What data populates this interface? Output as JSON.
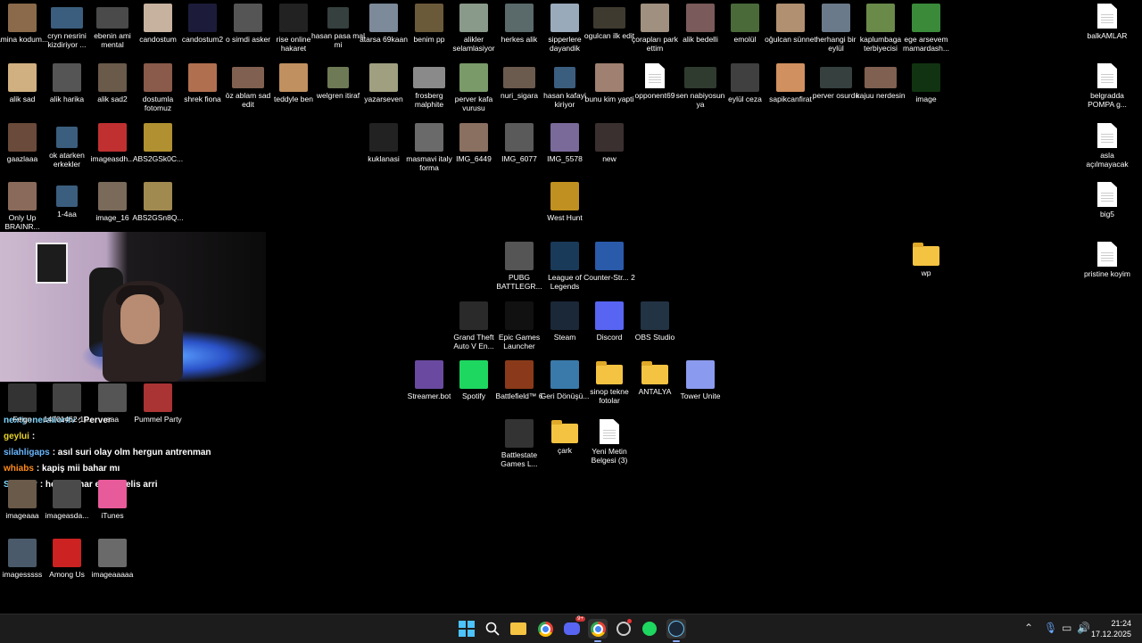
{
  "desktop": {
    "icons_left": [
      {
        "label": "amina kodum...",
        "icon": "image-thumb"
      },
      {
        "label": "cryn nesrini kizdiriyor ...",
        "icon": "video-thumb"
      },
      {
        "label": "ebenin ami mental",
        "icon": "video-thumb"
      },
      {
        "label": "candostum",
        "icon": "image-thumb"
      },
      {
        "label": "candostum2",
        "icon": "image-thumb"
      },
      {
        "label": "o simdi asker",
        "icon": "image-thumb"
      },
      {
        "label": "rise online hakaret",
        "icon": "image-thumb"
      },
      {
        "label": "hasan pasa mal mi",
        "icon": "image-thumb"
      },
      {
        "label": "atarsa 69kaan",
        "icon": "image-thumb"
      },
      {
        "label": "benim pp",
        "icon": "image-thumb"
      },
      {
        "label": "alikler selamlasiyor",
        "icon": "image-thumb"
      },
      {
        "label": "herkes alik",
        "icon": "image-thumb"
      },
      {
        "label": "sipperlere dayandik",
        "icon": "image-thumb"
      },
      {
        "label": "ogulcan ilk edit",
        "icon": "video-thumb"
      },
      {
        "label": "çorapları park ettim",
        "icon": "image-thumb"
      },
      {
        "label": "alik bedelli",
        "icon": "image-thumb"
      },
      {
        "label": "emolül",
        "icon": "image-thumb"
      },
      {
        "label": "oğulcan sünnet",
        "icon": "image-thumb"
      },
      {
        "label": "herhangi bir eylül",
        "icon": "image-thumb"
      },
      {
        "label": "kaplumbaga terbiyecisi",
        "icon": "image-thumb"
      },
      {
        "label": "ege arsevem mamardash...",
        "icon": "image-thumb"
      }
    ],
    "row2": [
      {
        "label": "alik sad"
      },
      {
        "label": "alik harika"
      },
      {
        "label": "alik sad2"
      },
      {
        "label": "dostumla fotomuz"
      },
      {
        "label": "shrek fiona"
      },
      {
        "label": "öz ablam sad edit"
      },
      {
        "label": "teddyle ben"
      },
      {
        "label": "welgren itiraf"
      },
      {
        "label": "yazarseven"
      },
      {
        "label": "frosberg malphite"
      },
      {
        "label": "perver kafa vurusu"
      },
      {
        "label": "nuri_sigara"
      },
      {
        "label": "hasan kafayi kiriyor"
      },
      {
        "label": "bunu kim yapti"
      },
      {
        "label": "opponent69"
      },
      {
        "label": "sen nabiyosun ya"
      },
      {
        "label": "eylül ceza"
      },
      {
        "label": "sapikcanfirat"
      },
      {
        "label": "perver osurdu"
      },
      {
        "label": "kajuu nerdesin"
      },
      {
        "label": "image"
      }
    ],
    "row3": [
      {
        "label": "gaazlaaa"
      },
      {
        "label": "ok atarken erkekler"
      },
      {
        "label": "imageasdh..."
      },
      {
        "label": "ABS2GSk0C..."
      },
      {
        "label": "kuklanasi"
      },
      {
        "label": "masmavi italy forma"
      },
      {
        "label": "IMG_6449"
      },
      {
        "label": "IMG_6077"
      },
      {
        "label": "IMG_5578"
      },
      {
        "label": "new"
      }
    ],
    "row4": [
      {
        "label": "Only Up BRAINR..."
      },
      {
        "label": "1-4aa"
      },
      {
        "label": "image_16"
      },
      {
        "label": "ABS2GSn8Q..."
      },
      {
        "label": "West Hunt"
      }
    ],
    "games": [
      {
        "label": "PUBG BATTLEGR..."
      },
      {
        "label": "League of Legends"
      },
      {
        "label": "Counter-Str... 2"
      }
    ],
    "apps": [
      {
        "label": "Grand Theft Auto V En..."
      },
      {
        "label": "Epic Games Launcher"
      },
      {
        "label": "Steam"
      },
      {
        "label": "Discord"
      },
      {
        "label": "OBS Studio"
      }
    ],
    "apps2": [
      {
        "label": "Streamer.bot"
      },
      {
        "label": "Spotify"
      },
      {
        "label": "Battlefield™ 6"
      },
      {
        "label": "Geri Dönüşü..."
      },
      {
        "label": "sinop tekne fotolar"
      },
      {
        "label": "ANTALYA"
      },
      {
        "label": "Tower Unite"
      }
    ],
    "apps3": [
      {
        "label": "Battlestate Games L..."
      },
      {
        "label": "çark"
      },
      {
        "label": "Yeni Metin Belgesi (3)"
      }
    ],
    "bottom_left": [
      {
        "label": "Feign"
      },
      {
        "label": "14701462-1..."
      },
      {
        "label": "aaa"
      },
      {
        "label": "Pummel Party"
      },
      {
        "label": "imageaaa"
      },
      {
        "label": "imageasda..."
      },
      {
        "label": "iTunes"
      },
      {
        "label": "imagesssss"
      },
      {
        "label": "Among Us"
      },
      {
        "label": "imageaaaaa"
      }
    ],
    "wp": {
      "label": "wp"
    },
    "right_docs": [
      {
        "label": "balkAMLAR"
      },
      {
        "label": "belgradda POMPA g..."
      },
      {
        "label": "asla açılmayacak"
      },
      {
        "label": "big5"
      },
      {
        "label": "pristine koyim"
      }
    ]
  },
  "chat": [
    {
      "user": "nextgenerationtv",
      "msg": ": Perver",
      "color": "#7fd7ff"
    },
    {
      "user": "geylui",
      "msg": ":",
      "color": "#e8d32a"
    },
    {
      "user": "silahligaps",
      "msg": ": asıl suri olay olm hergun antrenman",
      "color": "#6ab7ff"
    },
    {
      "user": "whiabs",
      "msg": ": kapiş mii bahar mı",
      "color": "#ff8c1a"
    },
    {
      "user": "Skelwer",
      "msg": ": helal bahar eylül melis arri",
      "color": "#7fd7ff"
    }
  ],
  "taskbar": {
    "time": "21:24",
    "date": "17.12.2025",
    "badge": "9+"
  }
}
